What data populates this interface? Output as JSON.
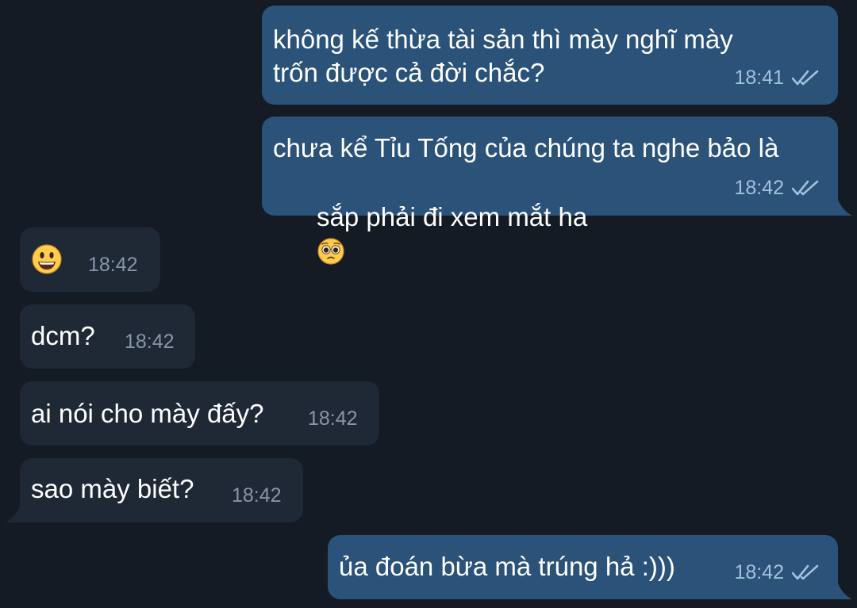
{
  "colors": {
    "background": "#141b24",
    "outgoing_bubble": "#2b5278",
    "incoming_bubble": "#1f2936",
    "outgoing_time": "#a4c0dc",
    "incoming_time": "#8596a8",
    "read_ticks": "#a4c0dc"
  },
  "messages": [
    {
      "direction": "outgoing",
      "lines": [
        "không kế thừa tài sản thì mày nghĩ mày",
        "trốn được cả đời chắc?"
      ],
      "time": "18:41",
      "status": "read-double-check-icon"
    },
    {
      "direction": "outgoing",
      "lines": [
        "chưa kể Tỉu Tống của chúng ta nghe bảo là",
        "sắp phải đi xem mắt ha"
      ],
      "emoji": "pleading-face-icon",
      "time": "18:42",
      "status": "read-double-check-icon"
    },
    {
      "direction": "incoming",
      "emoji": "grinning-face-icon",
      "time": "18:42"
    },
    {
      "direction": "incoming",
      "text": "dcm?",
      "time": "18:42"
    },
    {
      "direction": "incoming",
      "text": "ai nói cho mày đấy?",
      "time": "18:42"
    },
    {
      "direction": "incoming",
      "text": "sao mày biết?",
      "time": "18:42"
    },
    {
      "direction": "outgoing",
      "text": "ủa đoán bừa mà trúng hả :)))",
      "time": "18:42",
      "status": "read-double-check-icon"
    }
  ]
}
